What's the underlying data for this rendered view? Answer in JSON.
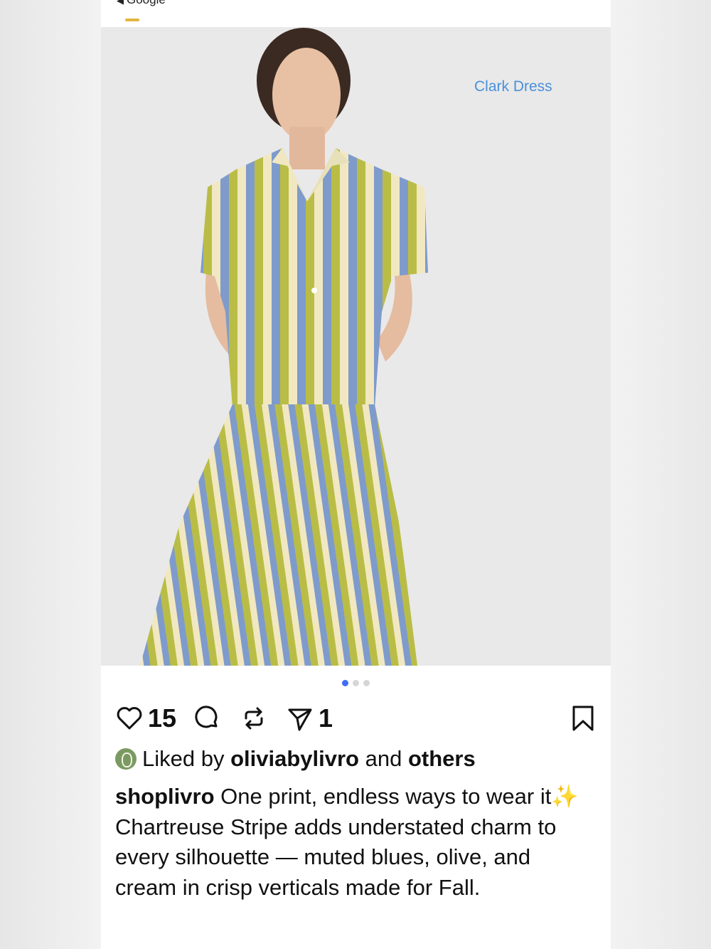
{
  "topbar": {
    "back_label": "Google"
  },
  "post": {
    "product_tag": "Clark Dress",
    "carousel": {
      "count": 3,
      "active": 0
    },
    "likes_count": "15",
    "shares_count": "1",
    "liked_by_prefix": "Liked by",
    "liked_by_user": "oliviabylivro",
    "liked_by_and": "and",
    "liked_by_others": "others",
    "caption_user": "shoplivro",
    "caption_part1": "One print, endless ways to wear it",
    "caption_emoji": "✨",
    "caption_part2": "Chartreuse Stripe adds understated charm to every silhouette — muted blues, olive, and cream in crisp verticals made for Fall."
  },
  "icons": {
    "heart": "heart-icon",
    "comment": "comment-icon",
    "repost": "repost-icon",
    "share": "share-icon",
    "bookmark": "bookmark-icon"
  },
  "colors": {
    "tag": "#4a90d9",
    "dot_active": "#3f6ef4",
    "stripe_olive": "#b9bd45",
    "stripe_blue": "#7f9bcc",
    "stripe_cream": "#f1e8c2"
  }
}
